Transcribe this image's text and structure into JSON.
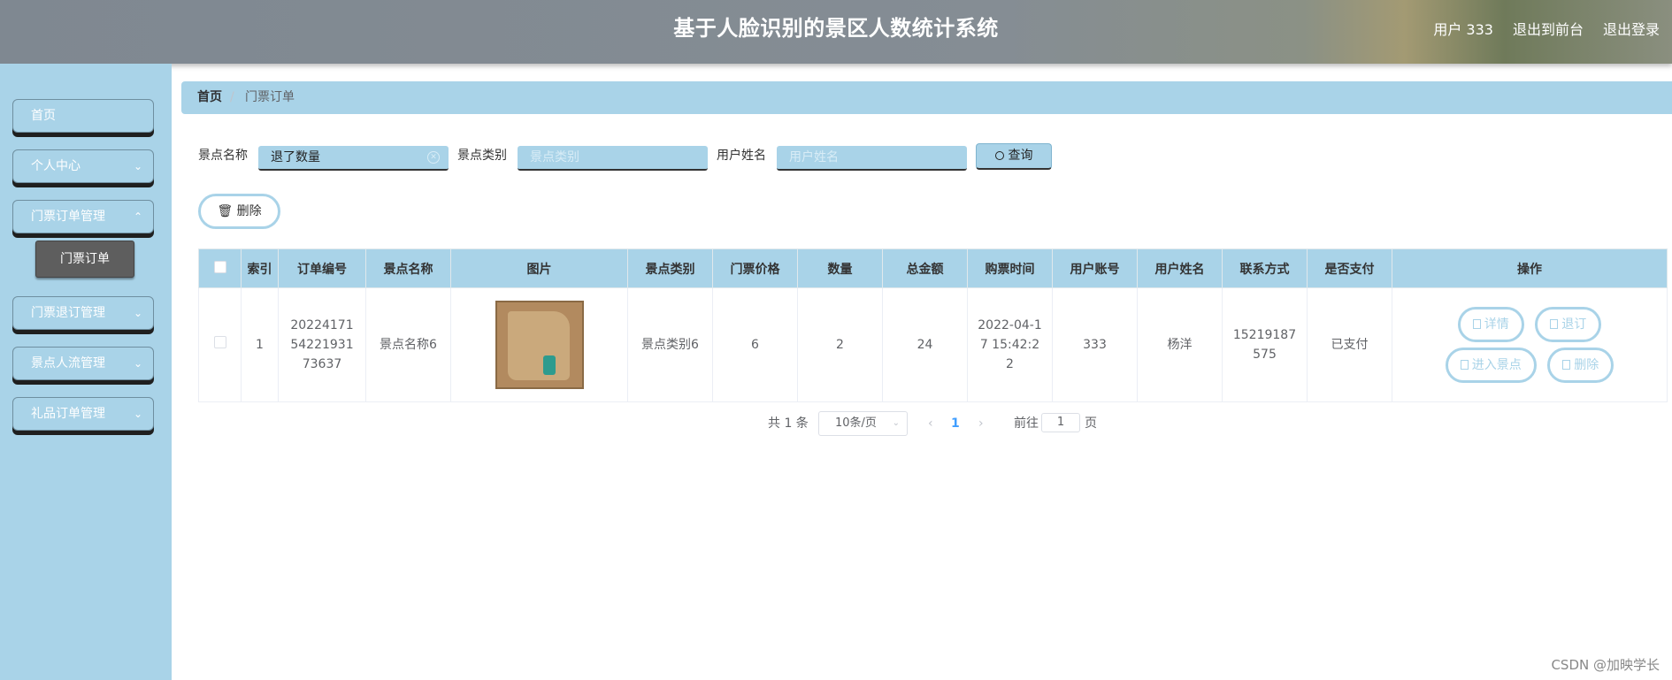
{
  "header": {
    "title": "基于人脸识别的景区人数统计系统",
    "user": "用户 333",
    "to_front": "退出到前台",
    "logout": "退出登录"
  },
  "sidebar": {
    "items": [
      {
        "label": "首页",
        "has_children": false
      },
      {
        "label": "个人中心",
        "has_children": true
      },
      {
        "label": "门票订单管理",
        "has_children": true
      },
      {
        "label": "门票退订管理",
        "has_children": true
      },
      {
        "label": "景点人流管理",
        "has_children": true
      },
      {
        "label": "礼品订单管理",
        "has_children": true
      }
    ],
    "active_sub": "门票订单"
  },
  "breadcrumb": {
    "home": "首页",
    "separator": "/",
    "current": "门票订单"
  },
  "search": {
    "spot_name_label": "景点名称",
    "spot_name_value": "退了数量",
    "spot_type_label": "景点类别",
    "spot_type_placeholder": "景点类别",
    "user_name_label": "用户姓名",
    "user_name_placeholder": "用户姓名",
    "query_button": "查询"
  },
  "toolbar": {
    "delete_button": "删除"
  },
  "table": {
    "headers": [
      "索引",
      "订单编号",
      "景点名称",
      "图片",
      "景点类别",
      "门票价格",
      "数量",
      "总金额",
      "购票时间",
      "用户账号",
      "用户姓名",
      "联系方式",
      "是否支付",
      "操作"
    ],
    "rows": [
      {
        "index": "1",
        "order_no": "202241715422193173637",
        "spot_name": "景点名称6",
        "spot_type": "景点类别6",
        "price": "6",
        "quantity": "2",
        "total": "24",
        "purchase_time": "2022-04-17 15:42:22",
        "account": "333",
        "user_name": "杨洋",
        "phone": "15219187575",
        "paid": "已支付",
        "actions": [
          "详情",
          "退订",
          "进入景点",
          "删除"
        ]
      }
    ]
  },
  "pagination": {
    "total_text": "共 1 条",
    "page_size": "10条/页",
    "current_page": "1",
    "goto_label": "前往",
    "goto_value": "1",
    "page_suffix": "页"
  },
  "watermark": "CSDN @加映学长",
  "colors": {
    "accent": "#a9d3e8",
    "sub_active": "#5e5e5e"
  }
}
